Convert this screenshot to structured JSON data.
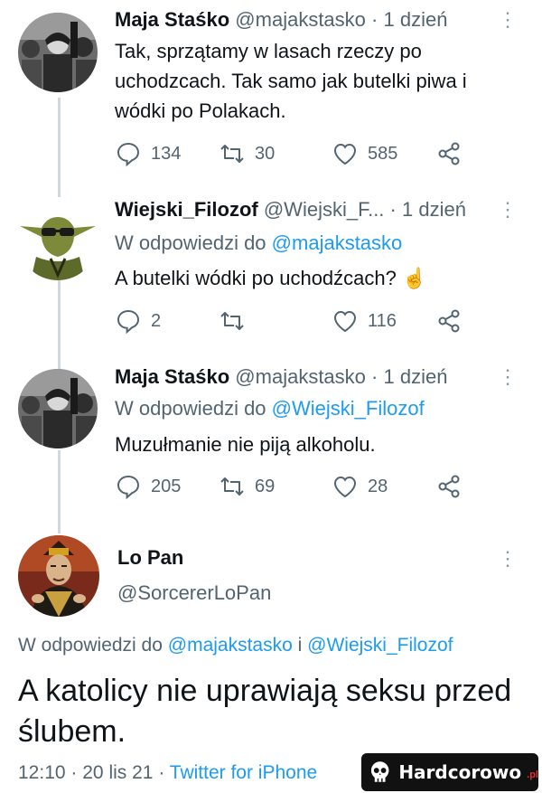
{
  "tweets": [
    {
      "name": "Maja Staśko",
      "handle": "@majakstasko",
      "sep": "·",
      "time": "1 dzień",
      "reply_prefix": "",
      "reply_to": "",
      "text": "Tak, sprzątamy w lasach rzeczy po uchodzcach. Tak samo jak butelki piwa i wódki po Polakach.",
      "replies": "134",
      "retweets": "30",
      "likes": "585",
      "avatar_icon": "crowd-photo-avatar"
    },
    {
      "name": "Wiejski_Filozof",
      "handle": "@Wiejski_F...",
      "sep": "·",
      "time": "1 dzień",
      "reply_prefix": "W odpowiedzi do",
      "reply_to": "@majakstasko",
      "text": "A butelki wódki po uchodźcach?",
      "emoji": "☝",
      "replies": "2",
      "retweets": "",
      "likes": "116",
      "avatar_icon": "yoda-sunglasses-avatar"
    },
    {
      "name": "Maja Staśko",
      "handle": "@majakstasko",
      "sep": "·",
      "time": "1 dzień",
      "reply_prefix": "W odpowiedzi do",
      "reply_to": "@Wiejski_Filozof",
      "text": "Muzułmanie nie piją alkoholu.",
      "replies": "205",
      "retweets": "69",
      "likes": "28",
      "avatar_icon": "crowd-photo-avatar"
    }
  ],
  "main": {
    "name": "Lo Pan",
    "handle": "@SorcererLoPan",
    "reply_prefix": "W odpowiedzi do",
    "reply_to_1": "@majakstasko",
    "reply_joiner": "i",
    "reply_to_2": "@Wiejski_Filozof",
    "text": "A katolicy nie uprawiają seksu przed ślubem.",
    "time": "12:10",
    "date": "20 lis 21",
    "sep": "·",
    "source": "Twitter for iPhone",
    "avatar_icon": "sorcerer-avatar"
  },
  "more_icon_glyph": "⋮",
  "watermark": {
    "text": "Hardcorowo",
    "tld": ".pl"
  },
  "colors": {
    "accent": "#1d9bf0",
    "secondary_text": "#536471",
    "thread_line": "#cfd9de"
  }
}
